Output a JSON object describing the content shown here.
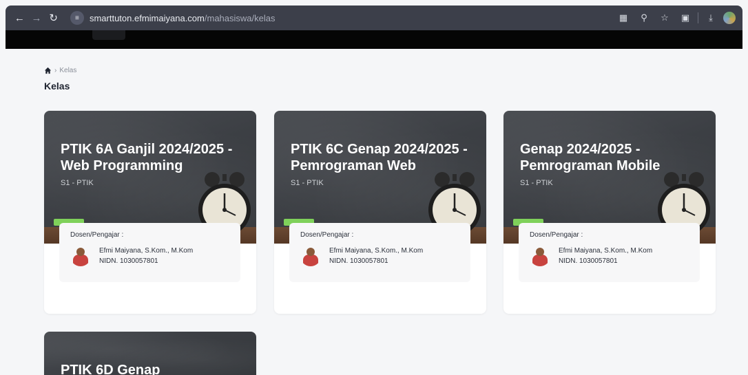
{
  "browser": {
    "url_host": "smarttuton.efmimaiyana.com",
    "url_path": "/mahasiswa/kelas"
  },
  "breadcrumb": {
    "current": "Kelas"
  },
  "page": {
    "title": "Kelas"
  },
  "teacher_label": "Dosen/Pengajar :",
  "cards": [
    {
      "title": "PTIK 6A Ganjil 2024/2025 - Web Programming",
      "subtitle": "S1 - PTIK",
      "teacher_name": "Efmi Maiyana, S.Kom., M.Kom",
      "teacher_nidn": "NIDN. 1030057801"
    },
    {
      "title": "PTIK 6C Genap 2024/2025 - Pemrograman Web",
      "subtitle": "S1 - PTIK",
      "teacher_name": "Efmi Maiyana, S.Kom., M.Kom",
      "teacher_nidn": "NIDN. 1030057801"
    },
    {
      "title": "Genap 2024/2025 - Pemrograman Mobile",
      "subtitle": "S1 - PTIK",
      "teacher_name": "Efmi Maiyana, S.Kom., M.Kom",
      "teacher_nidn": "NIDN. 1030057801"
    },
    {
      "title": "PTIK 6D Genap"
    }
  ],
  "colors": {
    "chrome": "#3c3f4a",
    "topbar": "#050505",
    "page_bg": "#f5f6f8",
    "board": "#3c3f44"
  }
}
